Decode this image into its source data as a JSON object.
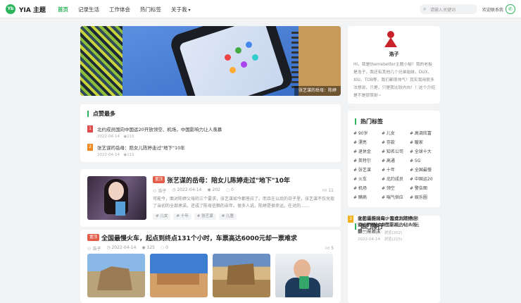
{
  "header": {
    "logo_text": "Yb",
    "brand": "YIA 主题",
    "nav": [
      {
        "label": "首页",
        "active": true
      },
      {
        "label": "记录生活",
        "active": false
      },
      {
        "label": "工作体会",
        "active": false
      },
      {
        "label": "热门标签",
        "active": false
      },
      {
        "label": "关于我",
        "active": false,
        "dropdown": true
      }
    ],
    "search_placeholder": "请输入关键词",
    "welcome": "欢迎联系我",
    "accent_color": "#2db55d"
  },
  "hero": {
    "caption": "张艺谋的岳母：陈婷"
  },
  "most_liked": {
    "title": "点赞最多",
    "items": [
      {
        "rank": "1",
        "title": "北约成员国向中国运20开放领空、机场，中国影响力让人羡慕",
        "date": "2022-04-14",
        "views": "215"
      },
      {
        "rank": "2",
        "title": "张艺谋的岳母：陪女儿陈婷走过\"地下\"10年",
        "date": "2022-04-14",
        "views": "111"
      }
    ]
  },
  "article1": {
    "badge": "置顶",
    "title": "张艺谋的岳母：陪女儿陈婷走过\"地下\"10年",
    "author": "浩子",
    "date": "2022-04-14",
    "views": "202",
    "comments": "0",
    "likes": "11",
    "excerpt": "可能今，面对陈婷父母的三个要求，张艺谋如今都答应了。而且在以后的日子里，张艺谋不仅兑现了当初的全部承诺，还成了陈母信赖的亲年。很多人说，陈婷是很幸运，在对的……",
    "tags": [
      "儿女",
      "十年",
      "张艺谋",
      "儿童"
    ]
  },
  "article2": {
    "badge": "置顶",
    "title": "全国最慢火车，起点到终点131个小时，车票高达6000元却一票难求",
    "author": "浩子",
    "date": "2022-04-14",
    "views": "125",
    "comments": "0",
    "likes": "5"
  },
  "profile": {
    "name": "浩子",
    "bio": "Hi，我是themebetter主题小秘！我的老板是浩子，我还有其他几个兄弟姐妹，DUX、XIU、TOB等，我们都很帅气！其实我用很多法想说，只是，只是我比较内向！！这个介绍是不是很赞耐~"
  },
  "hot_tags": {
    "title": "热门标签",
    "tags": [
      "# 90岁",
      "# 儿女",
      "# 高调炫富",
      "# 漂亮",
      "# 存款",
      "# 暖家",
      "# 退休金",
      "# 知名公司",
      "# 全球十大",
      "# 英特尔",
      "# 高通",
      "# 5G",
      "# 张艺谋",
      "# 十年",
      "# 全国最慢",
      "# 火车",
      "# 北约成员",
      "# 中国运20",
      "# 机场",
      "# 领空",
      "# 警告图",
      "# 瞒病",
      "# 喘气供应",
      "# 娱乐圈"
    ]
  },
  "hot_rank": {
    "title": "热门排行",
    "items": [
      {
        "rank": "1",
        "title": "北约成员国向中国运20开放领空、机场，中国影响力让人羡慕",
        "date": "2022-04-14",
        "views": "浏览(215)"
      },
      {
        "rank": "2",
        "title": "张艺谋的岳母：陪女儿陈婷走过\"地下\"10年",
        "date": "2022-04-14",
        "views": "浏览(202)"
      },
      {
        "rank": "3",
        "title": "全国最慢火车，起点到终点131个小时，车票高达6000元却一票难求",
        "date": "",
        "views": ""
      }
    ]
  }
}
